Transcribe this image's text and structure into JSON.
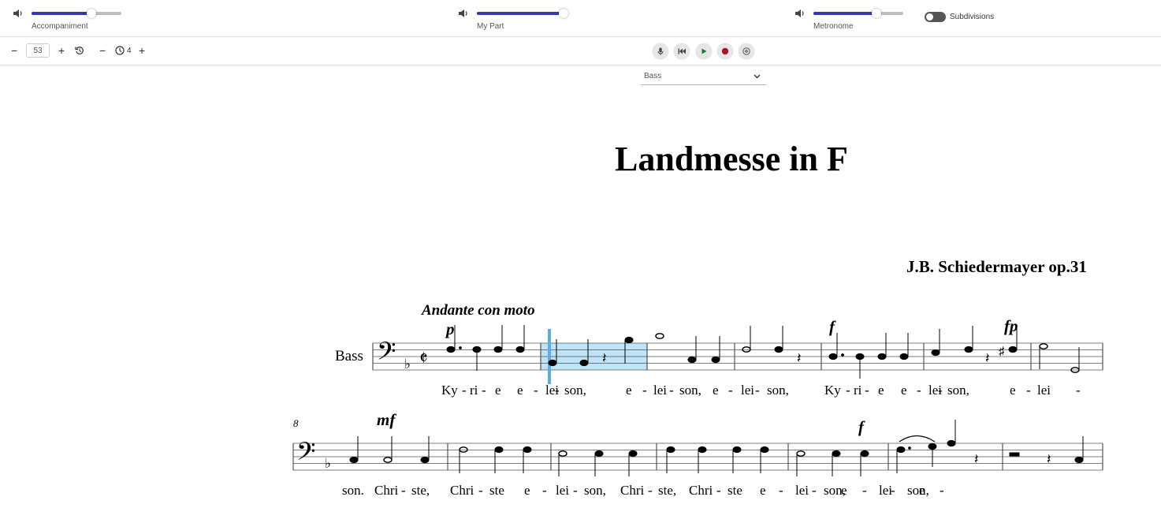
{
  "mixer": {
    "accompaniment": {
      "label": "Accompaniment",
      "level": 0.67
    },
    "my_part": {
      "label": "My Part",
      "level": 0.98
    },
    "metronome": {
      "label": "Metronome",
      "level": 0.7
    },
    "subdivisions": {
      "label": "Subdivisions",
      "on": false
    }
  },
  "toolbar": {
    "tempo_value": "53",
    "beats_value": "4"
  },
  "part_select": {
    "value": "Bass"
  },
  "score": {
    "title": "Landmesse in F",
    "composer": "J.B. Schiedermayer op.31",
    "tempo_marking": "Andante con moto",
    "instrument": "Bass",
    "system2_measure_number": "8",
    "dynamics": [
      "p",
      "f",
      "fp",
      "mf",
      "f"
    ],
    "lyrics_line1": [
      "Ky",
      "-",
      "ri",
      "-",
      "e",
      "e",
      "-",
      "lei",
      "-",
      "son,",
      "e",
      "-",
      "lei",
      "-",
      "son,",
      "e",
      "-",
      "lei",
      "-",
      "son,",
      "Ky",
      "-",
      "ri",
      "-",
      "e",
      "e",
      "-",
      "lei",
      "-",
      "son,",
      "e",
      "-",
      "lei",
      "-"
    ],
    "lyrics_line2": [
      "son.",
      "Chri",
      "-",
      "ste,",
      "Chri",
      "-",
      "ste",
      "e",
      "-",
      "lei",
      "-",
      "son,",
      "Chri",
      "-",
      "ste,",
      "Chri",
      "-",
      "ste",
      "e",
      "-",
      "lei",
      "-",
      "son,",
      "e",
      "-",
      "lei",
      "-",
      "son,",
      "e",
      "-"
    ]
  },
  "colors": {
    "slider": "#3a37b0",
    "highlight": "#bfe3f7",
    "cursor": "#5aaee0",
    "record": "#b0102a",
    "play": "#1b7a3a"
  }
}
